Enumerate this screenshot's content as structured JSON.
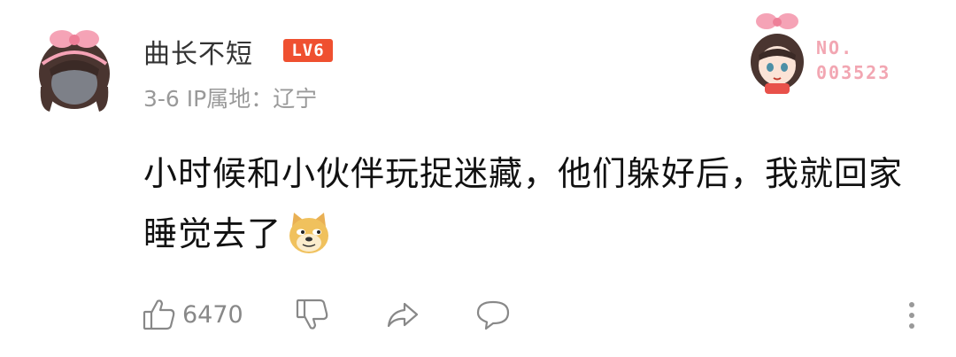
{
  "comment": {
    "username": "曲长不短",
    "level": "LV6",
    "date": "3-6",
    "location": "IP属地：辽宁",
    "text": "小时候和小伙伴玩捉迷藏，他们躲好后，我就回家睡觉去了",
    "emoji": "doge-emoji"
  },
  "badge": {
    "label": "NO.",
    "number": "003523"
  },
  "actions": {
    "like_count": "6470",
    "icons": [
      "thumbs-up-icon",
      "thumbs-down-icon",
      "share-icon",
      "reply-icon",
      "more-icon"
    ]
  },
  "colors": {
    "level_badge": "#ef5030",
    "badge_text": "#f2a6b2",
    "meta_text": "#999999",
    "icon": "#888888"
  }
}
